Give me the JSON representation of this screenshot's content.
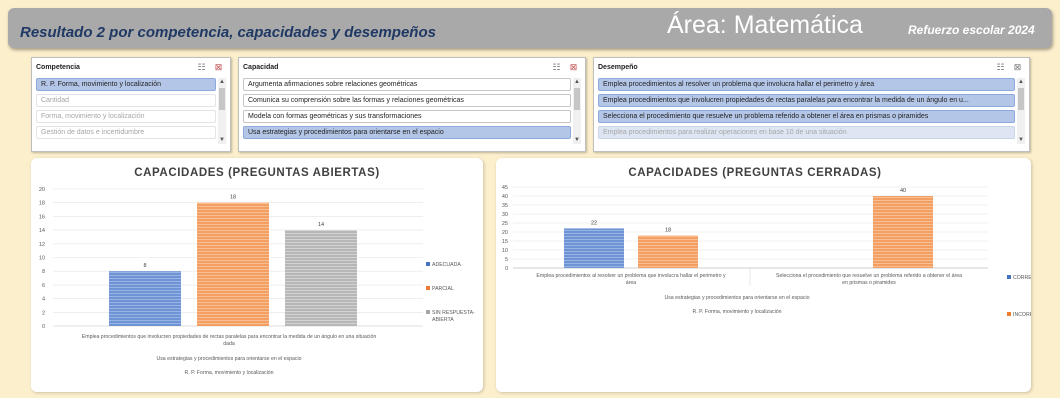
{
  "header": {
    "subtitle": "Resultado 2 por competencia, capacidades y desempeños",
    "area": "Área: Matemática",
    "year": "Refuerzo escolar 2024"
  },
  "slicers": {
    "competencia": {
      "title": "Competencia",
      "items": [
        {
          "label": "R. P. Forma, movimiento y localización",
          "state": "selected"
        },
        {
          "label": "Cantidad",
          "state": "dim"
        },
        {
          "label": "Forma, movimiento y localización",
          "state": "dim"
        },
        {
          "label": "Gestión de datos e incertidumbre",
          "state": "dim"
        }
      ]
    },
    "capacidad": {
      "title": "Capacidad",
      "items": [
        {
          "label": "Argumenta afirmaciones sobre relaciones geométricas",
          "state": "normal"
        },
        {
          "label": "Comunica su comprensión sobre las formas y relaciones geométricas",
          "state": "normal"
        },
        {
          "label": "Modela  con formas geométricas y sus transformaciones",
          "state": "normal"
        },
        {
          "label": "Usa estrategias y procedimientos para orientarse en el espacio",
          "state": "selected"
        }
      ]
    },
    "desempeno": {
      "title": "Desempeño",
      "items": [
        {
          "label": "Emplea procedimientos al resolver un problema que involucra hallar el perimetro y área",
          "state": "selected"
        },
        {
          "label": "Emplea procedimientos que involucren propiedades de rectas paralelas para encontrar la medida de un ángulo en u...",
          "state": "selected"
        },
        {
          "label": "Selecciona el procedimiento que resuelve un problema referido a obtener el área en prismas o piramides",
          "state": "selected"
        },
        {
          "label": "Emplea procedimientos para realizar operaciones en base 10 de una situación",
          "state": "seldim"
        }
      ]
    }
  },
  "chart_data": [
    {
      "type": "bar",
      "title": "CAPACIDADES (PREGUNTAS ABIERTAS)",
      "ylim": [
        0,
        20
      ],
      "yticks": [
        0,
        2,
        4,
        6,
        8,
        10,
        12,
        14,
        16,
        18,
        20
      ],
      "category_levels": [
        "Emplea procedimientos que involucren propiedades de rectas paralelas para encontrar la medida de un ángulo en una situación dada",
        "Usa estrategias y procedimientos para orientarse en el espacio",
        "R. P. Forma, movimiento y localización"
      ],
      "series": [
        {
          "name": "ADECUADA",
          "values": [
            8
          ],
          "color": "#4472c4"
        },
        {
          "name": "PARCIAL",
          "values": [
            18
          ],
          "color": "#ed7d31"
        },
        {
          "name": "SIN RESPUESTA-ABIERTA",
          "values": [
            14
          ],
          "color": "#a5a5a5"
        }
      ],
      "legend": "right"
    },
    {
      "type": "bar",
      "title": "CAPACIDADES (PREGUNTAS CERRADAS)",
      "ylim": [
        0,
        45
      ],
      "yticks": [
        0,
        5,
        10,
        15,
        20,
        25,
        30,
        35,
        40,
        45
      ],
      "categories": [
        "Emplea procedimientos al resolver un problema que involucra hallar el perimetro y área",
        "Selecciona el procedimiento que resuelve un problema referido a obtener el área en prismas o piramides"
      ],
      "category_levels": [
        "Usa estrategias y procedimientos para orientarse en el espacio",
        "R. P. Forma, movimiento y localización"
      ],
      "series": [
        {
          "name": "CORRECTA",
          "values": [
            22,
            null
          ],
          "color": "#4472c4"
        },
        {
          "name": "INCORRECTA",
          "values": [
            18,
            40
          ],
          "color": "#ed7d31"
        }
      ],
      "legend": "right"
    }
  ]
}
